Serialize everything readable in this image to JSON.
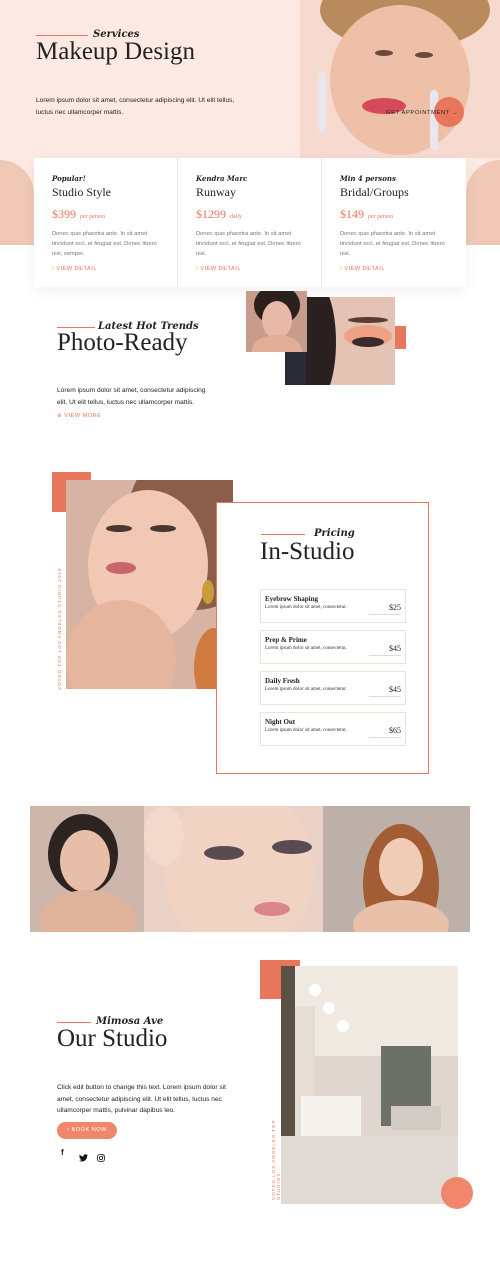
{
  "colors": {
    "accent": "#e8765b",
    "hero_bg": "#fde9e4"
  },
  "hero": {
    "script": "Services",
    "title": "Makeup Design",
    "text": "Lorem ipsum dolor sit amet, consectetur adipiscing elit. Ut elit tellus, luctus nec ullamcorper mattis.",
    "cta": "GET APPOINTMENT"
  },
  "services": [
    {
      "script": "Popular!",
      "title": "Studio Style",
      "price": "$399",
      "unit": "per person",
      "text": "Donec quis pharetra ante. In sit amet tincidunt orci, et feugiat est. Donec libero nisi, semper.",
      "link": "› VIEW DETAIL"
    },
    {
      "script": "Kendra Marc",
      "title": "Runway",
      "price": "$1299",
      "unit": "daily",
      "text": "Donec quis pharetra ante. In sit amet tincidunt orci, et feugiat est. Donec libero nisi.",
      "link": "› VIEW DETAIL"
    },
    {
      "script": "Min 4 persons",
      "title": "Bridal/Groups",
      "price": "$149",
      "unit": "per person",
      "text": "Donec quis pharetra ante. In sit amet tincidunt orci, et feugiat est. Donec libero nisi.",
      "link": "› VIEW DETAIL"
    }
  ],
  "trends": {
    "script": "Latest Hot Trends",
    "title": "Photo-Ready",
    "text": "Lorem ipsum dolor sit amet, consectetur adipiscing elit. Ut elit tellus, luctus nec ullamcorper mattis.",
    "link": "VIEW MORE"
  },
  "pricing": {
    "vertical": "VOTED TOP LOS ANGELES STUDIO 2019",
    "script": "Pricing",
    "title": "In-Studio",
    "items": [
      {
        "name": "Eyebrow Shaping",
        "desc": "Lorem ipsum dolor sit amet, consectetur.",
        "price": "$25"
      },
      {
        "name": "Prep & Prime",
        "desc": "Lorem ipsum dolor sit amet, consectetur.",
        "price": "$45"
      },
      {
        "name": "Daily Fresh",
        "desc": "Lorem ipsum dolor sit amet, consectetur.",
        "price": "$45"
      },
      {
        "name": "Night Out",
        "desc": "Lorem ipsum dolor sit amet, consectetur.",
        "price": "$65"
      }
    ]
  },
  "studio": {
    "script": "Mimosa Ave",
    "title": "Our Studio",
    "text": "Click edit button to change this text. Lorem ipsum dolor sit amet, consectetur adipiscing elit. Ut elit tellus, luctus nec ullamcorper mattis, pulvinar dapibus leo.",
    "cta": "BOOK NOW",
    "vertical": "VOTED LOS ANGELES TOP STUDIOS",
    "social": [
      "facebook-icon",
      "twitter-icon",
      "instagram-icon"
    ]
  }
}
